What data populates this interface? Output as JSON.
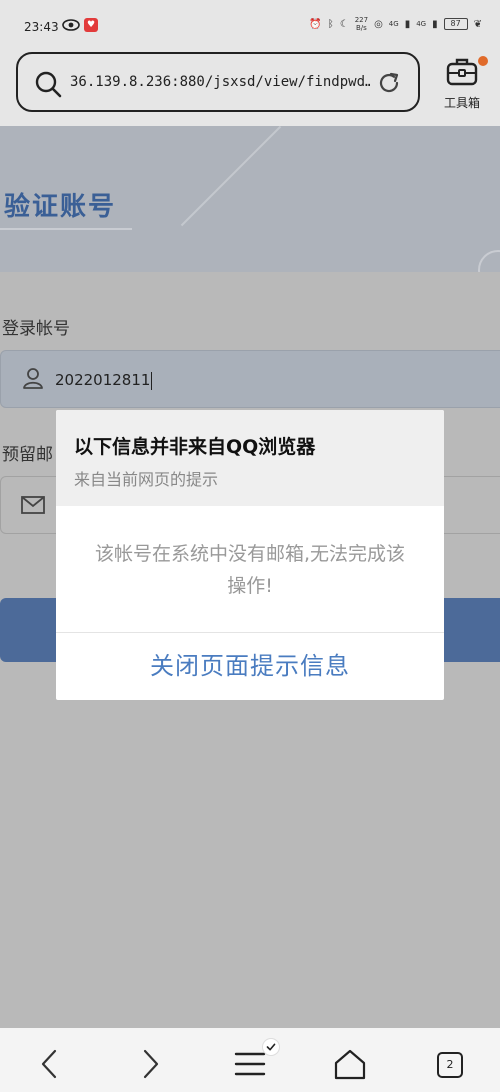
{
  "status_bar": {
    "time": "23:43",
    "network_speed_value": "227",
    "network_speed_unit": "B/s",
    "signal_1": "4G",
    "signal_2": "4G",
    "battery": "87"
  },
  "url_bar": {
    "url": "36.139.8.236:880/jsxsd/view/findpwd…"
  },
  "toolbox": {
    "label": "工具箱"
  },
  "page": {
    "title": "验证账号",
    "account_label": "登录帐号",
    "account_value": "2022012811",
    "email_label": "预留邮"
  },
  "dialog": {
    "title": "以下信息并非来自QQ浏览器",
    "subtitle": "来自当前网页的提示",
    "message": "该帐号在系统中没有邮箱,无法完成该操作!",
    "close_label": "关闭页面提示信息"
  },
  "bottom_nav": {
    "tab_count": "2"
  },
  "colors": {
    "accent": "#4a7cc0",
    "title_blue": "#3a5f96",
    "button_blue": "#4c6a99",
    "badge_orange": "#e06a2a"
  }
}
